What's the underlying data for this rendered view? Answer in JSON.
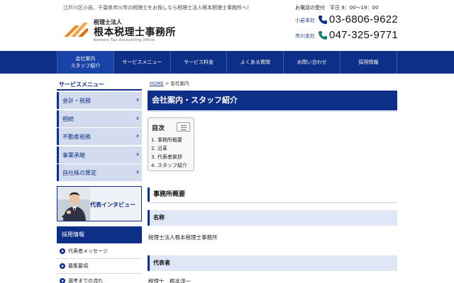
{
  "header": {
    "tagline": "江戸川区小岩、千葉県市川市の税理士をお探しなら税理士法人根本税理士事務所へ！",
    "logo_sub": "税理士法人",
    "logo_name": "根本税理士事務所",
    "logo_en": "Nemoto Tax Accounting Office",
    "phone_head": "お電話の受付　平日 9：00〜19：00",
    "phones": [
      {
        "branch": "小岩本社",
        "number": "03-6806-9622"
      },
      {
        "branch": "市川支社",
        "number": "047-325-9771"
      }
    ]
  },
  "nav": {
    "items": [
      {
        "label": "会社案内\nスタッフ紹介"
      },
      {
        "label": "サービスメニュー"
      },
      {
        "label": "サービス料金"
      },
      {
        "label": "よくある質問"
      },
      {
        "label": "お問い合わせ"
      },
      {
        "label": "採用情報"
      }
    ]
  },
  "sidebar": {
    "title": "サービスメニュー",
    "items": [
      {
        "label": "会計・税務"
      },
      {
        "label": "相続"
      },
      {
        "label": "不動産税務"
      },
      {
        "label": "事業承継"
      },
      {
        "label": "自社株の算定"
      }
    ],
    "banner_text": "代表インタビュー",
    "recruit_title": "採用情報",
    "recruit_items": [
      {
        "label": "代表者メッセージ"
      },
      {
        "label": "募集要項"
      },
      {
        "label": "選考までの流れ"
      }
    ]
  },
  "main": {
    "breadcrumb_home": "HOME",
    "breadcrumb_sep": ">",
    "breadcrumb_current": "会社案内",
    "page_title": "会社案内・スタッフ紹介",
    "toc": {
      "title": "目次",
      "items": [
        "1. 事務所概要",
        "2. 沿革",
        "3. 代表者挨拶",
        "4. スタッフ紹介"
      ]
    },
    "section_title": "事務所概要",
    "fields": [
      {
        "label": "名称",
        "value": "税理士法人根本税理士事務所"
      },
      {
        "label": "代表者",
        "value": "税理士　根本淳一"
      }
    ]
  },
  "colors": {
    "navy": "#0e2f87",
    "sidebar_item_bg": "#d3dbef",
    "section_head_bg": "#dfe6f5",
    "logo_orange": "#f08a1c"
  },
  "icons": {
    "phone": "phone-icon",
    "chevron": "chevron-right-icon",
    "bullet": "circle-arrow-icon",
    "toc_toggle": "list-toggle-icon"
  }
}
